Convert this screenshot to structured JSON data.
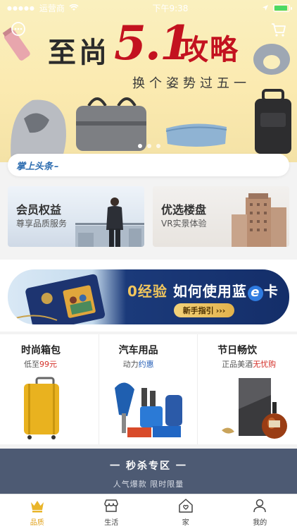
{
  "status_bar": {
    "carrier": "运营商",
    "time": "下午9:38"
  },
  "hero": {
    "title_prefix": "至尚",
    "title_number": "5.1",
    "title_suffix": "攻略",
    "subtitle": "换个姿势过五一",
    "slide_count": 3,
    "active_slide": 1
  },
  "ticker": {
    "logo": "掌上头条",
    "logo_tail": "–"
  },
  "features": [
    {
      "title": "会员权益",
      "subtitle": "尊享品质服务"
    },
    {
      "title": "优选楼盘",
      "subtitle": "VR实景体验"
    }
  ],
  "card_banner": {
    "title_gold": "0经验",
    "title_main": "如何使用蓝",
    "title_e": "e",
    "title_end": "卡",
    "button": "新手指引",
    "button_arrows": "›››"
  },
  "categories": [
    {
      "title": "时尚箱包",
      "sub_prefix": "低至",
      "sub_highlight": "99元"
    },
    {
      "title": "汽车用品",
      "sub_prefix": "动力",
      "sub_highlight": "约惠"
    },
    {
      "title": "节日畅饮",
      "sub_prefix": "正品美酒",
      "sub_highlight": "无忧购"
    }
  ],
  "flash_sale": {
    "title": "一 秒杀专区 一",
    "subtitle": "人气爆款 限时限量"
  },
  "tabs": [
    {
      "label": "品质",
      "icon": "crown-icon",
      "active": true
    },
    {
      "label": "生活",
      "icon": "shop-icon",
      "active": false
    },
    {
      "label": "家",
      "icon": "home-icon",
      "active": false
    },
    {
      "label": "我的",
      "icon": "person-icon",
      "active": false
    }
  ],
  "colors": {
    "accent": "#e1a11a",
    "hero_red": "#c3121f",
    "flash_bg": "#4d5a73",
    "card_navy": "#142e69",
    "card_gold": "#f1c65d"
  }
}
